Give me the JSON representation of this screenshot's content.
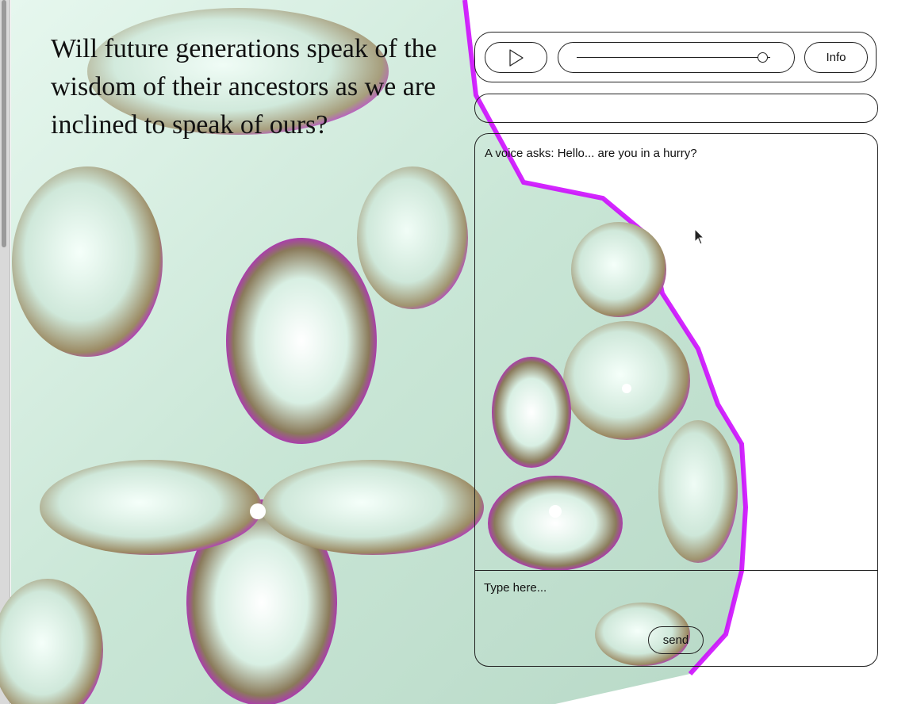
{
  "quote": {
    "text": "Will future generations speak of the wisdom of their ancestors as we are inclined to speak of ours?"
  },
  "player": {
    "play_icon": "play-icon",
    "volume_level": 0.96,
    "info_label": "Info"
  },
  "status": {
    "text": ""
  },
  "chat": {
    "messages": [
      "A voice asks: Hello... are you in a hurry?"
    ],
    "input_placeholder": "Type here...",
    "send_label": "send"
  },
  "colors": {
    "accent": "#cc00ff",
    "art_base": "#dff3ea",
    "art_shadow": "#8a7a5a",
    "outline": "#222222"
  }
}
